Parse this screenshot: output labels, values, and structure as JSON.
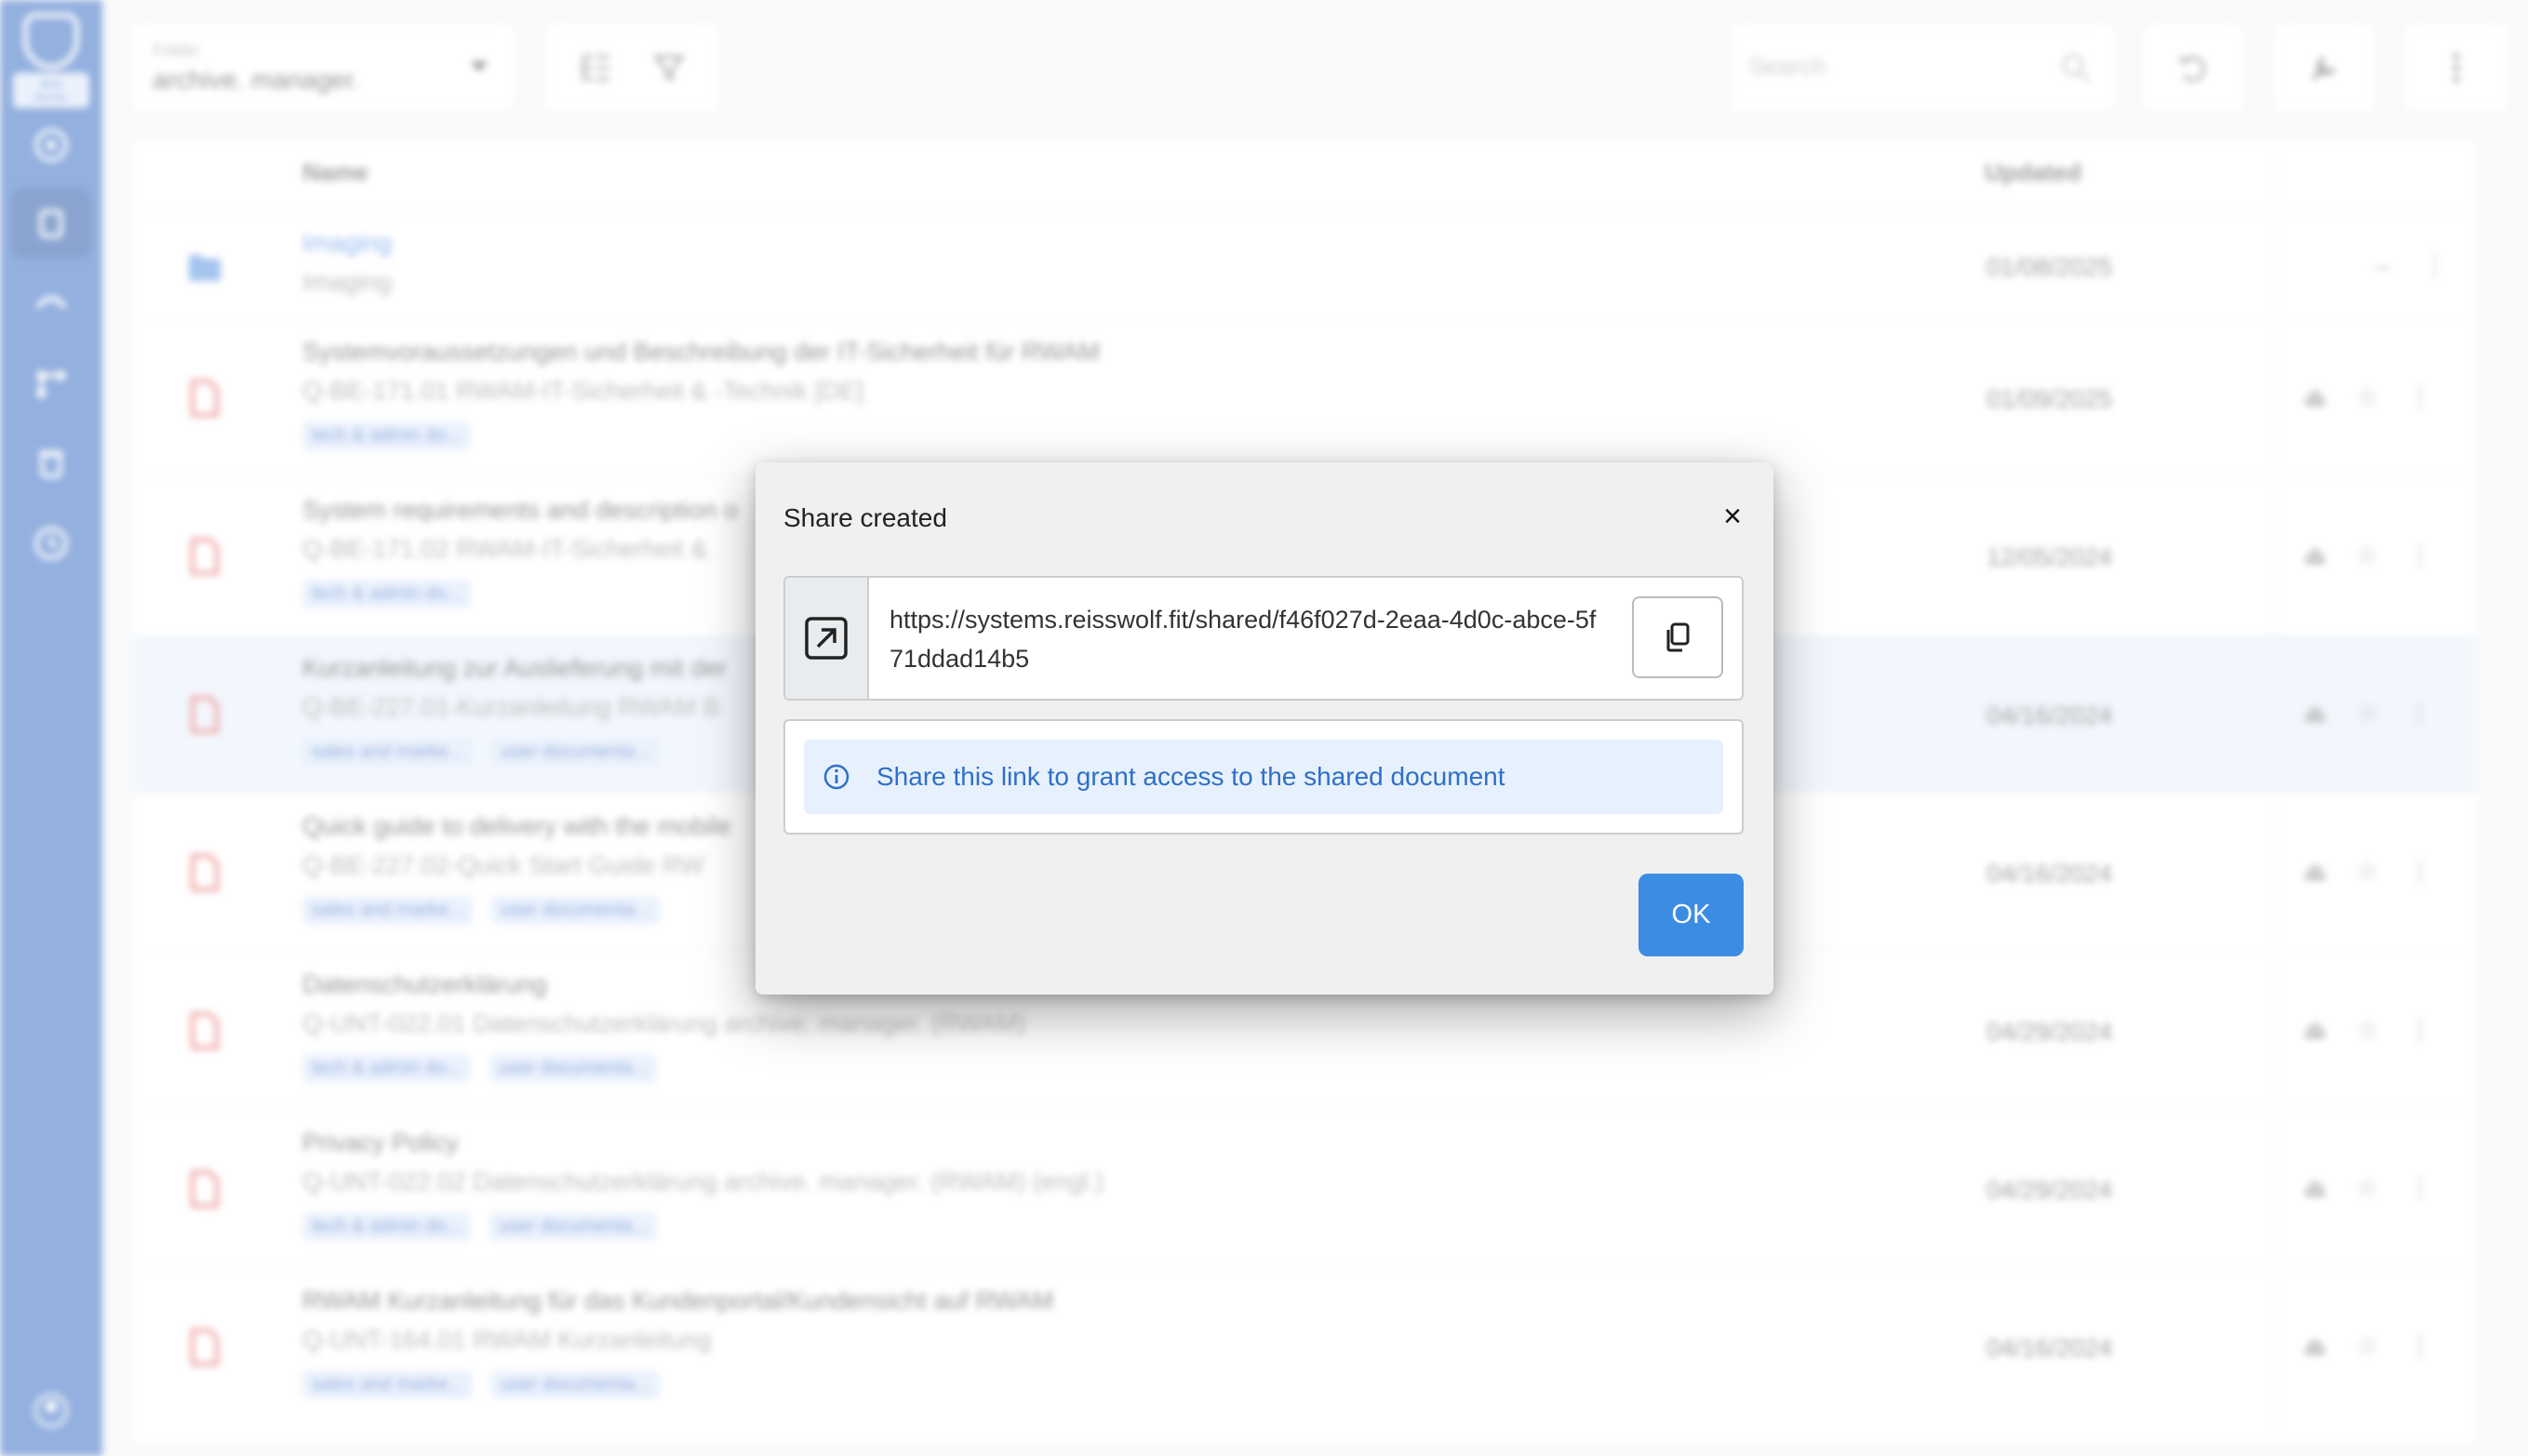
{
  "app": {
    "logo_tag": "Bob Archiv"
  },
  "toolbar": {
    "folder_label": "Folder",
    "folder_value": "archive. manager.",
    "search_placeholder": "Search"
  },
  "table": {
    "col_name": "Name",
    "col_updated": "Updated",
    "rows": [
      {
        "title": "Imaging",
        "sub": "Imaging",
        "tags": [],
        "date": "01/08/2025",
        "type": "folder"
      },
      {
        "title": "Systemvoraussetzungen und Beschreibung der IT-Sicherheit für RWAM",
        "sub": "Q-BE-171.01 RWAM-IT-Sicherheit & -Technik [DE]",
        "tags": [
          "tech & admin do..."
        ],
        "date": "01/09/2025",
        "type": "pdf"
      },
      {
        "title": "System requirements and description o",
        "sub": "Q-BE-171.02 RWAM-IT-Sicherheit &",
        "tags": [
          "tech & admin do..."
        ],
        "date": "12/05/2024",
        "type": "pdf"
      },
      {
        "title": "Kurzanleitung zur Auslieferung mit der",
        "sub": "Q-BE-227.01-Kurzanleitung RWAM B",
        "tags": [
          "sales and marke...",
          "user documenta..."
        ],
        "date": "04/16/2024",
        "type": "pdf"
      },
      {
        "title": "Quick guide to delivery with the mobile",
        "sub": "Q-BE-227.02-Quick Start Guide RW",
        "tags": [
          "sales and marke...",
          "user documenta..."
        ],
        "date": "04/16/2024",
        "type": "pdf"
      },
      {
        "title": "Datenschutzerklärung",
        "sub": "Q-UNT-022.01 Datenschutzerklärung archive. manager. (RWAM)",
        "tags": [
          "tech & admin do...",
          "user documenta..."
        ],
        "date": "04/29/2024",
        "type": "pdf"
      },
      {
        "title": "Privacy Policy",
        "sub": "Q-UNT-022.02 Datenschutzerklärung archive. manager. (RWAM) (engl.)",
        "tags": [
          "tech & admin do...",
          "user documenta..."
        ],
        "date": "04/29/2024",
        "type": "pdf"
      },
      {
        "title": "RWAM Kurzanleitung für das Kundenportal/Kundensicht auf RWAM",
        "sub": "Q-UNT-164.01 RWAM Kurzanleitung",
        "tags": [
          "sales and marke...",
          "user documenta..."
        ],
        "date": "04/16/2024",
        "type": "pdf"
      }
    ]
  },
  "dialog": {
    "title": "Share created",
    "close_symbol": "×",
    "link_url": "https://systems.reisswolf.fit/shared/f46f027d-2eaa-4d0c-abce-5f71ddad14b5",
    "info_text": "Share this link to grant access to the shared document",
    "ok_label": "OK"
  },
  "colors": {
    "sidebar": "#3b6fc4",
    "accent": "#3d8ce4",
    "info_bg": "#e7f1fd",
    "info_text": "#2f6fc9",
    "pdf_icon": "#e25656"
  }
}
